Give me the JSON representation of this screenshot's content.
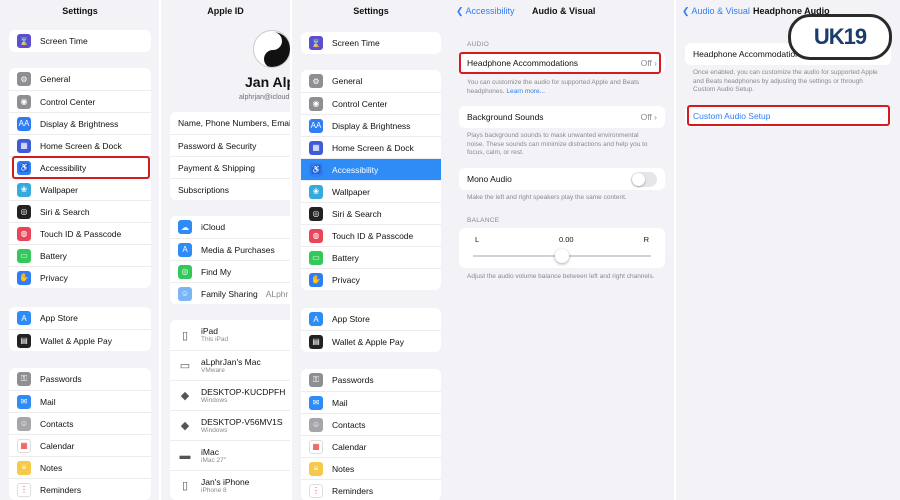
{
  "colors": {
    "accent": "#2f7ef5",
    "highlight": "#d71920",
    "selected": "#2f8cf6"
  },
  "settings_left": {
    "title": "Settings",
    "top_item": "Screen Time",
    "group1": [
      "General",
      "Control Center",
      "Display & Brightness",
      "Home Screen & Dock",
      "Accessibility",
      "Wallpaper",
      "Siri & Search",
      "Touch ID & Passcode",
      "Battery",
      "Privacy"
    ],
    "group2": [
      "App Store",
      "Wallet & Apple Pay"
    ],
    "group3": [
      "Passwords",
      "Mail",
      "Contacts",
      "Calendar",
      "Notes",
      "Reminders"
    ]
  },
  "apple_id": {
    "title": "Apple ID",
    "name": "Jan Alph",
    "email": "alphrjan@icloud",
    "menu": [
      "Name, Phone Numbers, Email",
      "Password & Security",
      "Payment & Shipping",
      "Subscriptions"
    ],
    "services": [
      "iCloud",
      "Media & Purchases",
      "Find My",
      "Family Sharing"
    ],
    "family_value": "ALphr",
    "devices": [
      {
        "name": "iPad",
        "sub": "This iPad"
      },
      {
        "name": "aLphrJan's Mac",
        "sub": "VMware"
      },
      {
        "name": "DESKTOP-KUCDPFH",
        "sub": "Windows"
      },
      {
        "name": "DESKTOP-V56MV1S",
        "sub": "Windows"
      },
      {
        "name": "iMac",
        "sub": "iMac 27\""
      },
      {
        "name": "Jan's iPhone",
        "sub": "iPhone 8"
      }
    ]
  },
  "settings_mid": {
    "title": "Settings",
    "top_item": "Screen Time",
    "group1": [
      "General",
      "Control Center",
      "Display & Brightness",
      "Home Screen & Dock",
      "Accessibility",
      "Wallpaper",
      "Siri & Search",
      "Touch ID & Passcode",
      "Battery",
      "Privacy"
    ],
    "group2": [
      "App Store",
      "Wallet & Apple Pay"
    ],
    "group3": [
      "Passwords",
      "Mail",
      "Contacts",
      "Calendar",
      "Notes",
      "Reminders"
    ]
  },
  "audio_visual": {
    "back": "Accessibility",
    "title": "Audio & Visual",
    "section_audio": "AUDIO",
    "headphone_label": "Headphone Accommodations",
    "headphone_value": "Off",
    "headphone_foot": "You can customize the audio for supported Apple and Beats headphones.",
    "learn_more": "Learn more...",
    "bg_label": "Background Sounds",
    "bg_value": "Off",
    "bg_foot": "Plays background sounds to mask unwanted environmental noise. These sounds can minimize distractions and help you to focus, calm, or rest.",
    "mono_label": "Mono Audio",
    "mono_foot": "Make the left and right speakers play the same content.",
    "section_balance": "BALANCE",
    "balance_left": "L",
    "balance_value": "0.00",
    "balance_right": "R",
    "balance_level": 0.5,
    "balance_foot": "Adjust the audio volume balance between left and right channels."
  },
  "headphone_audio": {
    "back": "Audio & Visual",
    "title": "Headphone Audio",
    "row_label": "Headphone Accommodations",
    "foot": "Once enabled, you can customize the audio for supported Apple and Beats headphones by adjusting the settings or through Custom Audio Setup.",
    "custom_setup": "Custom Audio Setup"
  },
  "watermark": {
    "text": "UK19"
  }
}
